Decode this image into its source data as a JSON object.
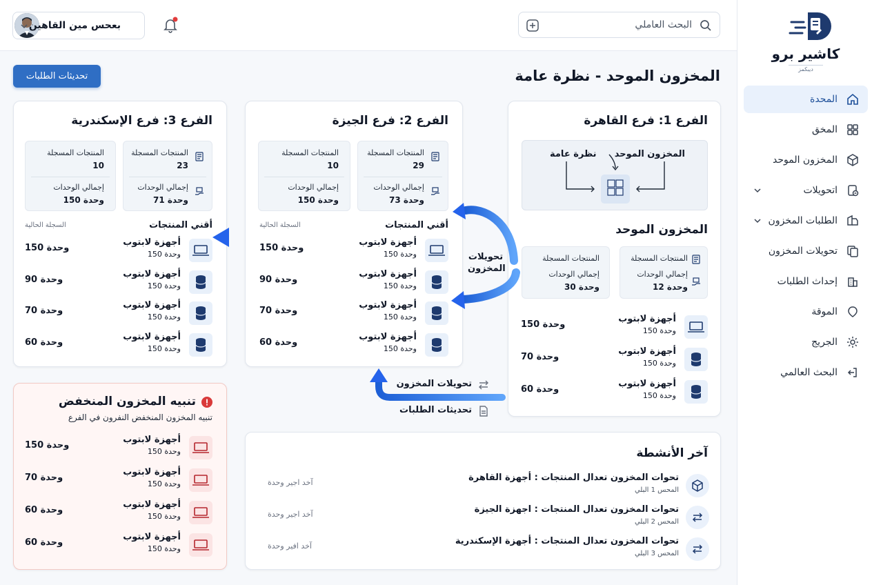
{
  "app": {
    "name": "كاشير برو",
    "tagline": "ديبكمز"
  },
  "sidebar": {
    "items": [
      {
        "label": "المحدة",
        "icon": "home-icon",
        "active": true
      },
      {
        "label": "المخق",
        "icon": "grid-icon"
      },
      {
        "label": "المخزون الموحد",
        "icon": "box-icon"
      },
      {
        "label": "اتحويلات",
        "icon": "transfer-icon",
        "has_chevron": true
      },
      {
        "label": "الطلبات المخزون",
        "icon": "orders-icon",
        "has_chevron": true
      },
      {
        "label": "تحويلات المخزون",
        "icon": "copy-icon"
      },
      {
        "label": "إحداث الطلبات",
        "icon": "building-icon"
      },
      {
        "label": "الموقة",
        "icon": "location-icon"
      },
      {
        "label": "الجريج",
        "icon": "gear-icon"
      },
      {
        "label": "البحث العالمي",
        "icon": "logout-icon"
      }
    ]
  },
  "header": {
    "search_placeholder": "البحث العاملي",
    "user_name": "بعحس مين القاهين"
  },
  "page": {
    "title": "المخزون الموحد - نظرة عامة",
    "primary_button": "تحديثات الطلبات"
  },
  "branch1": {
    "title": "الفرع 1: فرع القاهرة",
    "flow": {
      "unified": "المخزون الموحد",
      "overview": "نظرة عامة"
    },
    "section_title": "المخزون الموحد",
    "stats": {
      "registered_label": "المنتجات المسجلة",
      "units_label": "إجمالي الوحدات",
      "units_value": "12 وحدة",
      "registered_label_2": "المنتجات المسجلة",
      "units_label_2": "إجمالي الوحدات",
      "units_value_2": "30 وحدة"
    },
    "products": [
      {
        "name": "أجهزة لابتوب",
        "qty": "150 وحدة",
        "value": "150 وحدة",
        "icon": "laptop-icon"
      },
      {
        "name": "أجهزة لابتوب",
        "qty": "150 وحدة",
        "value": "70 وحدة",
        "icon": "database-icon"
      },
      {
        "name": "أجهزة لابتوب",
        "qty": "150 وحدة",
        "value": "60 وحدة",
        "icon": "database-icon"
      }
    ]
  },
  "branch2": {
    "title": "الفرع 2: فرع الجيزة",
    "stats": {
      "registered_label": "المنتجات المسجلة",
      "registered_value": "29",
      "units_label": "إجمالي الوحدات",
      "units_value": "73 وحدة",
      "registered_label_2": "المنتجات المسجلة",
      "registered_value_2": "10",
      "units_label_2": "إجمالي الوحدات",
      "units_value_2": "150 وحدة"
    },
    "section_title": "أقني المنتجات",
    "section_note": "السجلة الحالية",
    "products": [
      {
        "name": "أجهزة لابتوب",
        "qty": "150 وحدة",
        "value": "150 وحدة",
        "icon": "laptop-icon"
      },
      {
        "name": "أجهزة لابتوب",
        "qty": "150 وحدة",
        "value": "90 وحدة",
        "icon": "database-icon"
      },
      {
        "name": "أجهزة لابتوب",
        "qty": "150 وحدة",
        "value": "70 وحدة",
        "icon": "database-icon"
      },
      {
        "name": "أجهزة لابتوب",
        "qty": "150 وحدة",
        "value": "60 وحدة",
        "icon": "database-icon"
      }
    ]
  },
  "branch3": {
    "title": "الفرع 3: فرع الإسكندرية",
    "stats": {
      "registered_label": "المنتجات المسجلة",
      "registered_value": "23",
      "units_label": "إجمالي الوحدات",
      "units_value": "71 وحدة",
      "registered_label_2": "المنتجات المسجلة",
      "registered_value_2": "10",
      "units_label_2": "إجمالي الوحدات",
      "units_value_2": "150 وحدة"
    },
    "section_title": "أقني المنتجات",
    "section_note": "السجلة الحالية",
    "products": [
      {
        "name": "أجهزة لابتوب",
        "qty": "150 وحدة",
        "value": "150 وحدة",
        "icon": "laptop-icon"
      },
      {
        "name": "أجهزة لابتوب",
        "qty": "150 وحدة",
        "value": "90 وحدة",
        "icon": "database-icon"
      },
      {
        "name": "أجهزة لابتوب",
        "qty": "150 وحدة",
        "value": "70 وحدة",
        "icon": "database-icon"
      },
      {
        "name": "أجهزة لابتوب",
        "qty": "150 وحدة",
        "value": "60 وحدة",
        "icon": "database-icon"
      }
    ]
  },
  "transfers_label": "تحويلات المخزون",
  "bottom_labels": {
    "transfers": "تحويلات المخزون",
    "orders": "تحديثات الطلبات"
  },
  "alert": {
    "title": "تنبيه المخزون المنخفض",
    "subtitle": "تنبيه المخزون المنخفض النفرون في الفرع",
    "products": [
      {
        "name": "أجهزة لابتوب",
        "qty": "150 وحدة",
        "value": "150 وحدة"
      },
      {
        "name": "أجهزة لابتوب",
        "qty": "150 وحدة",
        "value": "70 وحدة"
      },
      {
        "name": "أجهزة لابتوب",
        "qty": "150 وحدة",
        "value": "60 وحدة"
      },
      {
        "name": "أجهزة لابتوب",
        "qty": "150 وحدة",
        "value": "60 وحدة"
      }
    ]
  },
  "activities": {
    "title": "آخر الأنشطة",
    "items": [
      {
        "title": "تحوات المخزون تعدال المنتجات : أجهزة القاهرة",
        "sub": "المحس 1 البلي",
        "note": "آخد اجير وحدة",
        "icon": "box-icon"
      },
      {
        "title": "تحوات المخزون تعدال المنتجات : اجهزة الجيزة",
        "sub": "المحس 2 البلي",
        "note": "آخد اجير وحدة",
        "icon": "transfer-icon"
      },
      {
        "title": "تحوات المخزون تعدال المنتجات : أجهزة الإسكندرية",
        "sub": "المحس 3 البلي",
        "note": "آخد افير وحدة",
        "icon": "transfer-icon"
      }
    ]
  },
  "colors": {
    "accent": "#2f6ec4",
    "alert": "#d14b4b",
    "arrow": "#3b82f6"
  }
}
